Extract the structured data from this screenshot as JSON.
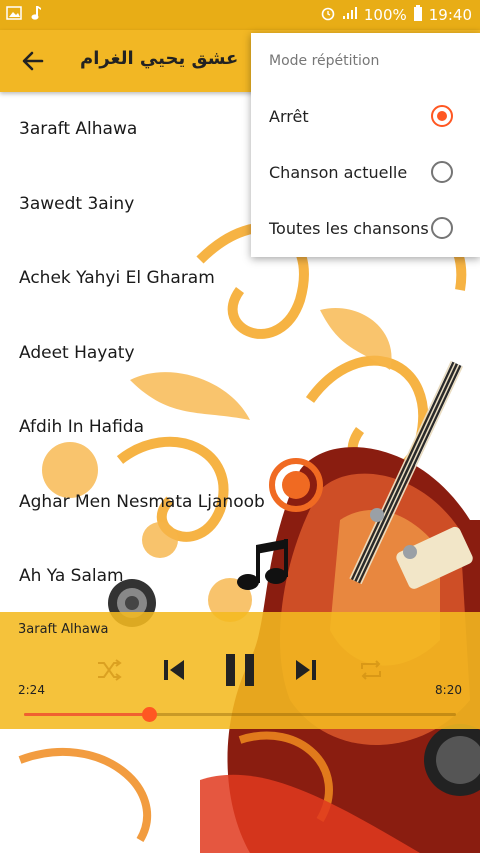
{
  "status_bar": {
    "battery": "100%",
    "time": "19:40",
    "icons": [
      "image-icon",
      "music-note-icon",
      "alarm-icon",
      "signal-icon",
      "battery-icon"
    ]
  },
  "app_bar": {
    "title": "عشق يحيي الغرام",
    "back_icon": "back-arrow-icon"
  },
  "songs": [
    "3araft Alhawa",
    "3awedt 3ainy",
    "Achek Yahyi El Gharam",
    "Adeet Hayaty",
    "Afdih In Hafida",
    "Aghar Men Nesmata Ljanoob",
    "Ah Ya Salam"
  ],
  "player": {
    "now_playing": "3araft Alhawa",
    "current_time": "2:24",
    "total_time": "8:20",
    "progress": 0.29,
    "controls": [
      "shuffle-icon",
      "previous-icon",
      "pause-icon",
      "next-icon",
      "repeat-icon"
    ]
  },
  "repeat_menu": {
    "title": "Mode répétition",
    "options": [
      {
        "label": "Arrêt",
        "checked": true
      },
      {
        "label": "Chanson actuelle",
        "checked": false
      },
      {
        "label": "Toutes les chansons",
        "checked": false
      }
    ]
  },
  "colors": {
    "accent": "#f2b724",
    "status_bar": "#e8ad16",
    "radio_active": "#ff5722"
  }
}
